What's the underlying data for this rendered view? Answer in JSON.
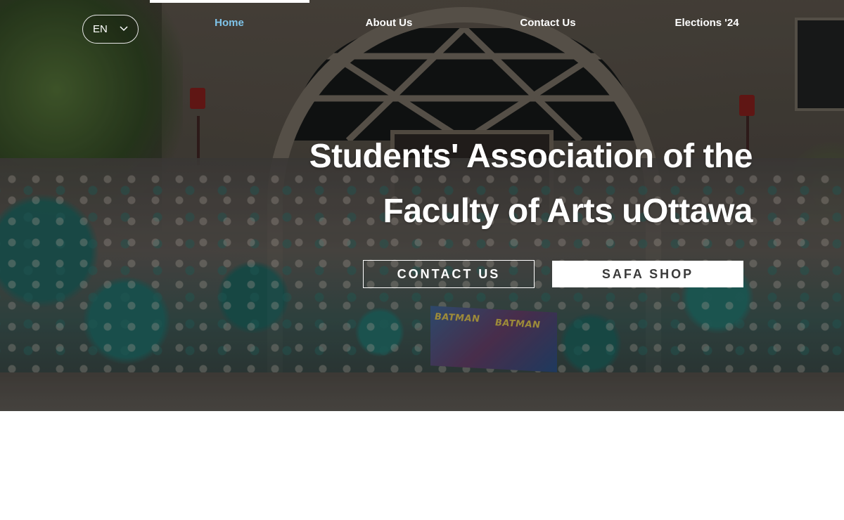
{
  "language": {
    "current": "EN",
    "icon": "chevron-down-icon"
  },
  "nav": {
    "items": [
      {
        "label": "Home",
        "active": true
      },
      {
        "label": "About Us",
        "active": false
      },
      {
        "label": "Contact Us",
        "active": false
      },
      {
        "label": "Elections '24",
        "active": false
      }
    ],
    "active_color": "#7fc4ea"
  },
  "hero": {
    "title_line1": "Students' Association of the",
    "title_line2": "Faculty of Arts uOttawa",
    "primary_button": "CONTACT US",
    "secondary_button": "SAFA SHOP",
    "banner_text_left": "BATMAN",
    "banner_text_right": "BATMAN"
  }
}
